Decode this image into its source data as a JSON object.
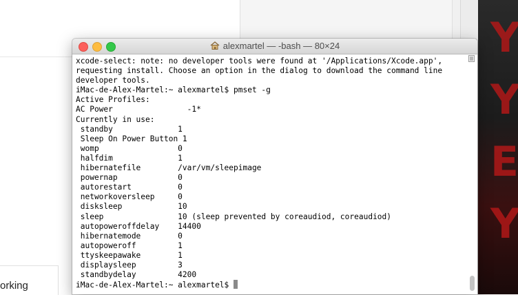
{
  "background": {
    "partial_text": "orking"
  },
  "terminal": {
    "title": "alexmartel — -bash — 80×24",
    "lines": [
      "xcode-select: note: no developer tools were found at '/Applications/Xcode.app',",
      "requesting install. Choose an option in the dialog to download the command line",
      "developer tools.",
      "iMac-de-Alex-Martel:~ alexmartel$ pmset -g",
      "Active Profiles:",
      "AC Power                -1*",
      "Currently in use:",
      " standby              1",
      " Sleep On Power Button 1",
      " womp                 0",
      " halfdim              1",
      " hibernatefile        /var/vm/sleepimage",
      " powernap             0",
      " autorestart          0",
      " networkoversleep     0",
      " disksleep            10",
      " sleep                10 (sleep prevented by coreaudiod, coreaudiod)",
      " autopoweroffdelay    14400",
      " hibernatemode        0",
      " autopoweroff         1",
      " ttyskeepawake        1",
      " displaysleep         3",
      " standbydelay         4200"
    ],
    "prompt": "iMac-de-Alex-Martel:~ alexmartel$ "
  },
  "icons": {
    "title_icon": "home-icon",
    "scroll_marker": "scroll-marker-icon"
  },
  "colors": {
    "close": "#fc605c",
    "minimize": "#fdbc40",
    "maximize": "#34c84a"
  }
}
